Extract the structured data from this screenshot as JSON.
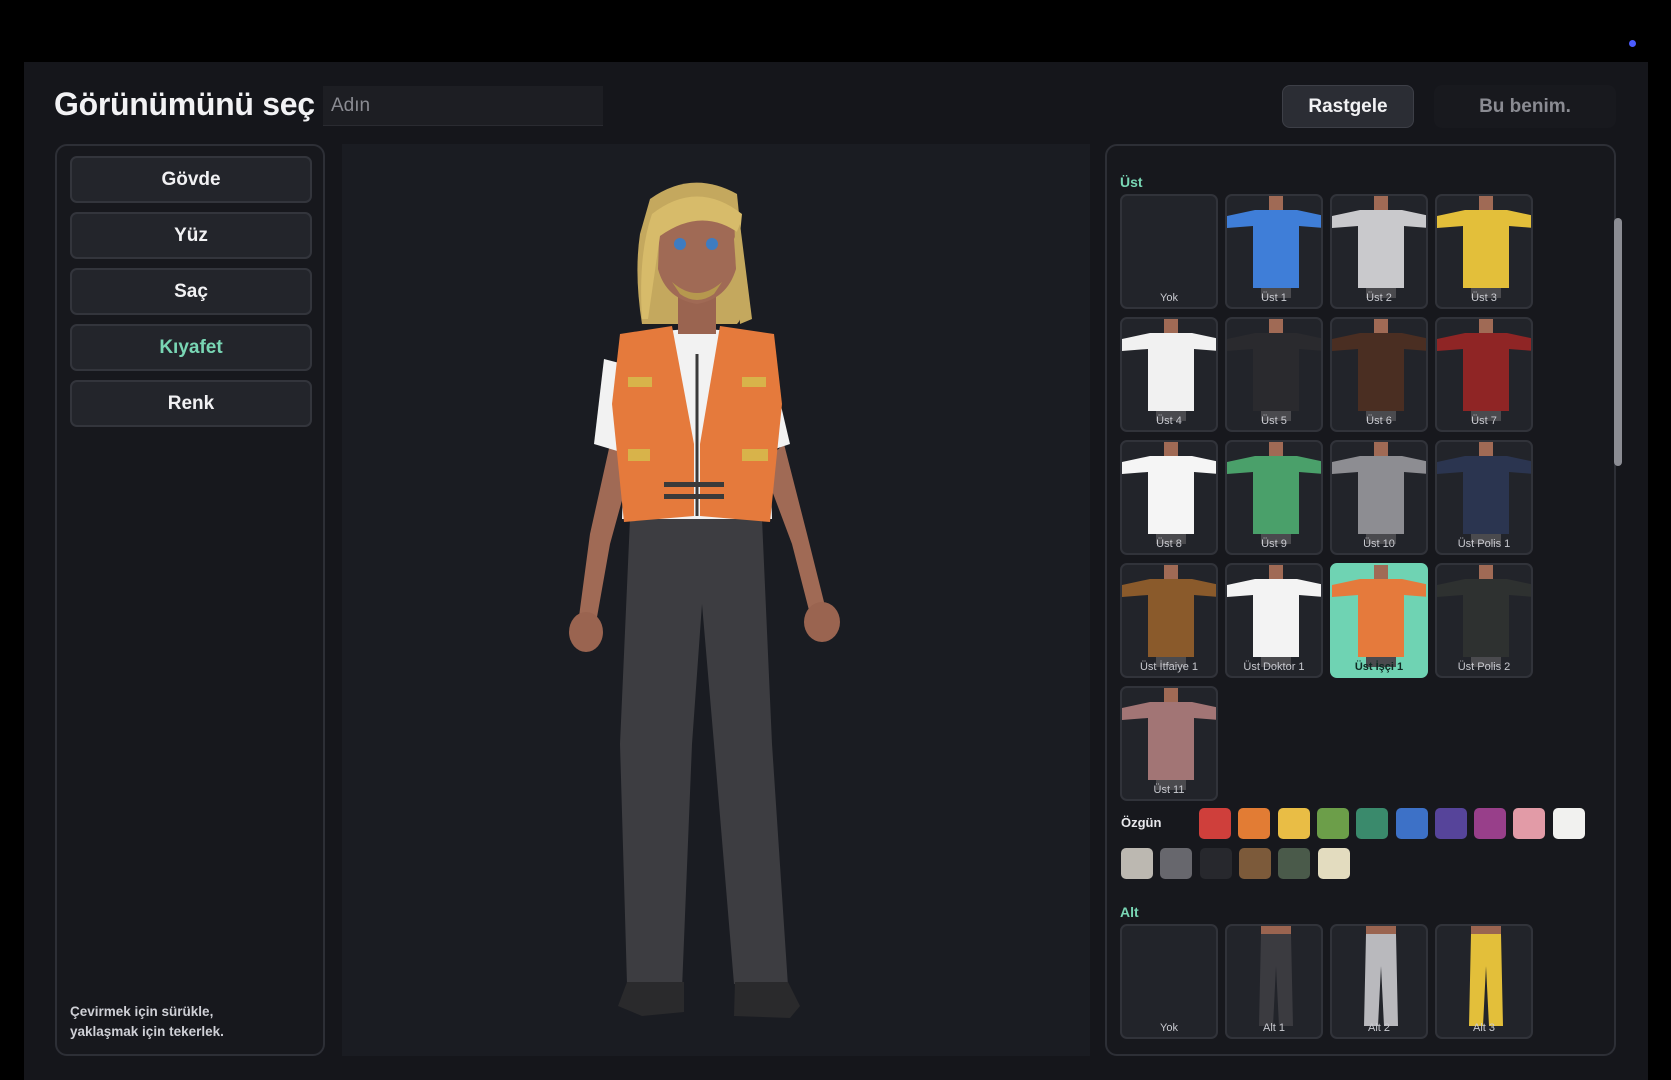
{
  "header": {
    "title": "Görünümünü seç",
    "name_placeholder": "Adın",
    "random_label": "Rastgele",
    "confirm_label": "Bu benim."
  },
  "categories": [
    {
      "label": "Gövde"
    },
    {
      "label": "Yüz"
    },
    {
      "label": "Saç"
    },
    {
      "label": "Kıyafet",
      "active": true
    },
    {
      "label": "Renk"
    }
  ],
  "hint": {
    "line1": "Çevirmek için sürükle,",
    "line2": "yaklaşmak için tekerlek."
  },
  "top_section": {
    "label": "Üst",
    "items": [
      {
        "label": "Yok",
        "color": ""
      },
      {
        "label": "Üst 1",
        "color": "#3f7ed8"
      },
      {
        "label": "Üst 2",
        "color": "#c9c9cc"
      },
      {
        "label": "Üst 3",
        "color": "#e3bf3a"
      },
      {
        "label": "Üst 4",
        "color": "#f1f1f1"
      },
      {
        "label": "Üst 5",
        "color": "#2a2a2e"
      },
      {
        "label": "Üst 6",
        "color": "#4a2e22"
      },
      {
        "label": "Üst 7",
        "color": "#8f2525"
      },
      {
        "label": "Üst 8",
        "color": "#f5f5f5"
      },
      {
        "label": "Üst 9",
        "color": "#4aa06a"
      },
      {
        "label": "Üst 10",
        "color": "#8d8d92"
      },
      {
        "label": "Üst Polis 1",
        "color": "#2b3550"
      },
      {
        "label": "Üst İtfaiye 1",
        "color": "#8a5a2b"
      },
      {
        "label": "Üst Doktor 1",
        "color": "#f3f3f3"
      },
      {
        "label": "Üst İşçi 1",
        "color": "#e57a3c",
        "selected": true
      },
      {
        "label": "Üst Polis 2",
        "color": "#2e3130"
      },
      {
        "label": "Üst 11",
        "color": "#a27575"
      }
    ]
  },
  "colors": {
    "original_label": "Özgün",
    "swatches": [
      "#cf3f3b",
      "#e27c34",
      "#e9bd45",
      "#6c9e49",
      "#3a8a6c",
      "#3d71c7",
      "#56449a",
      "#983f8a",
      "#e29ba7",
      "#f1f1ef",
      "#bcb8b1",
      "#67676d",
      "#27282d",
      "#7c5a3a",
      "#4a5a4a",
      "#e3dcbf"
    ]
  },
  "bottom_section": {
    "label": "Alt",
    "items": [
      {
        "label": "Yok",
        "color": ""
      },
      {
        "label": "Alt 1",
        "color": "#3b3b40"
      },
      {
        "label": "Alt 2",
        "color": "#b9b9bd"
      },
      {
        "label": "Alt 3",
        "color": "#e3bf3a"
      }
    ]
  }
}
